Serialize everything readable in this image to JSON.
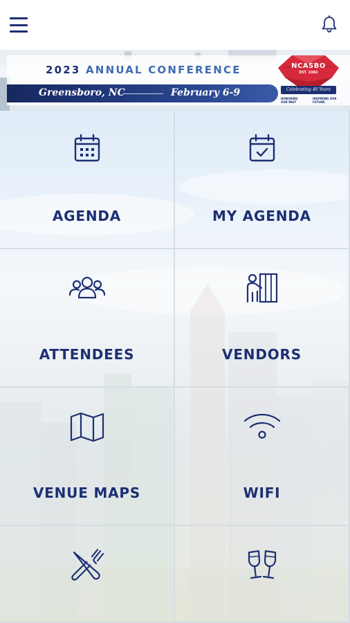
{
  "header": {
    "menu_icon": "hamburger-menu-icon",
    "notification_icon": "bell-icon"
  },
  "banner": {
    "year": "2023",
    "title": "ANNUAL CONFERENCE",
    "city": "Greensboro, NC",
    "dates": "February 6-9",
    "logo": {
      "name": "NCASBO",
      "established": "EST. 1982",
      "motto": "Celebrating 40 Years",
      "tagline_left": "HONORING OUR PAST",
      "tagline_right": "INSPIRING OUR FUTURE"
    }
  },
  "tiles": [
    {
      "label": "AGENDA",
      "icon": "calendar-icon"
    },
    {
      "label": "MY AGENDA",
      "icon": "calendar-check-icon"
    },
    {
      "label": "ATTENDEES",
      "icon": "users-group-icon"
    },
    {
      "label": "VENDORS",
      "icon": "presenter-booth-icon"
    },
    {
      "label": "VENUE MAPS",
      "icon": "map-icon"
    },
    {
      "label": "WIFI",
      "icon": "wifi-icon"
    },
    {
      "label": "",
      "icon": "fork-knife-icon"
    },
    {
      "label": "",
      "icon": "cheers-glasses-icon"
    }
  ],
  "colors": {
    "primary": "#1c2f73",
    "accent": "#3f6bb3",
    "logo_red": "#d6293b"
  }
}
